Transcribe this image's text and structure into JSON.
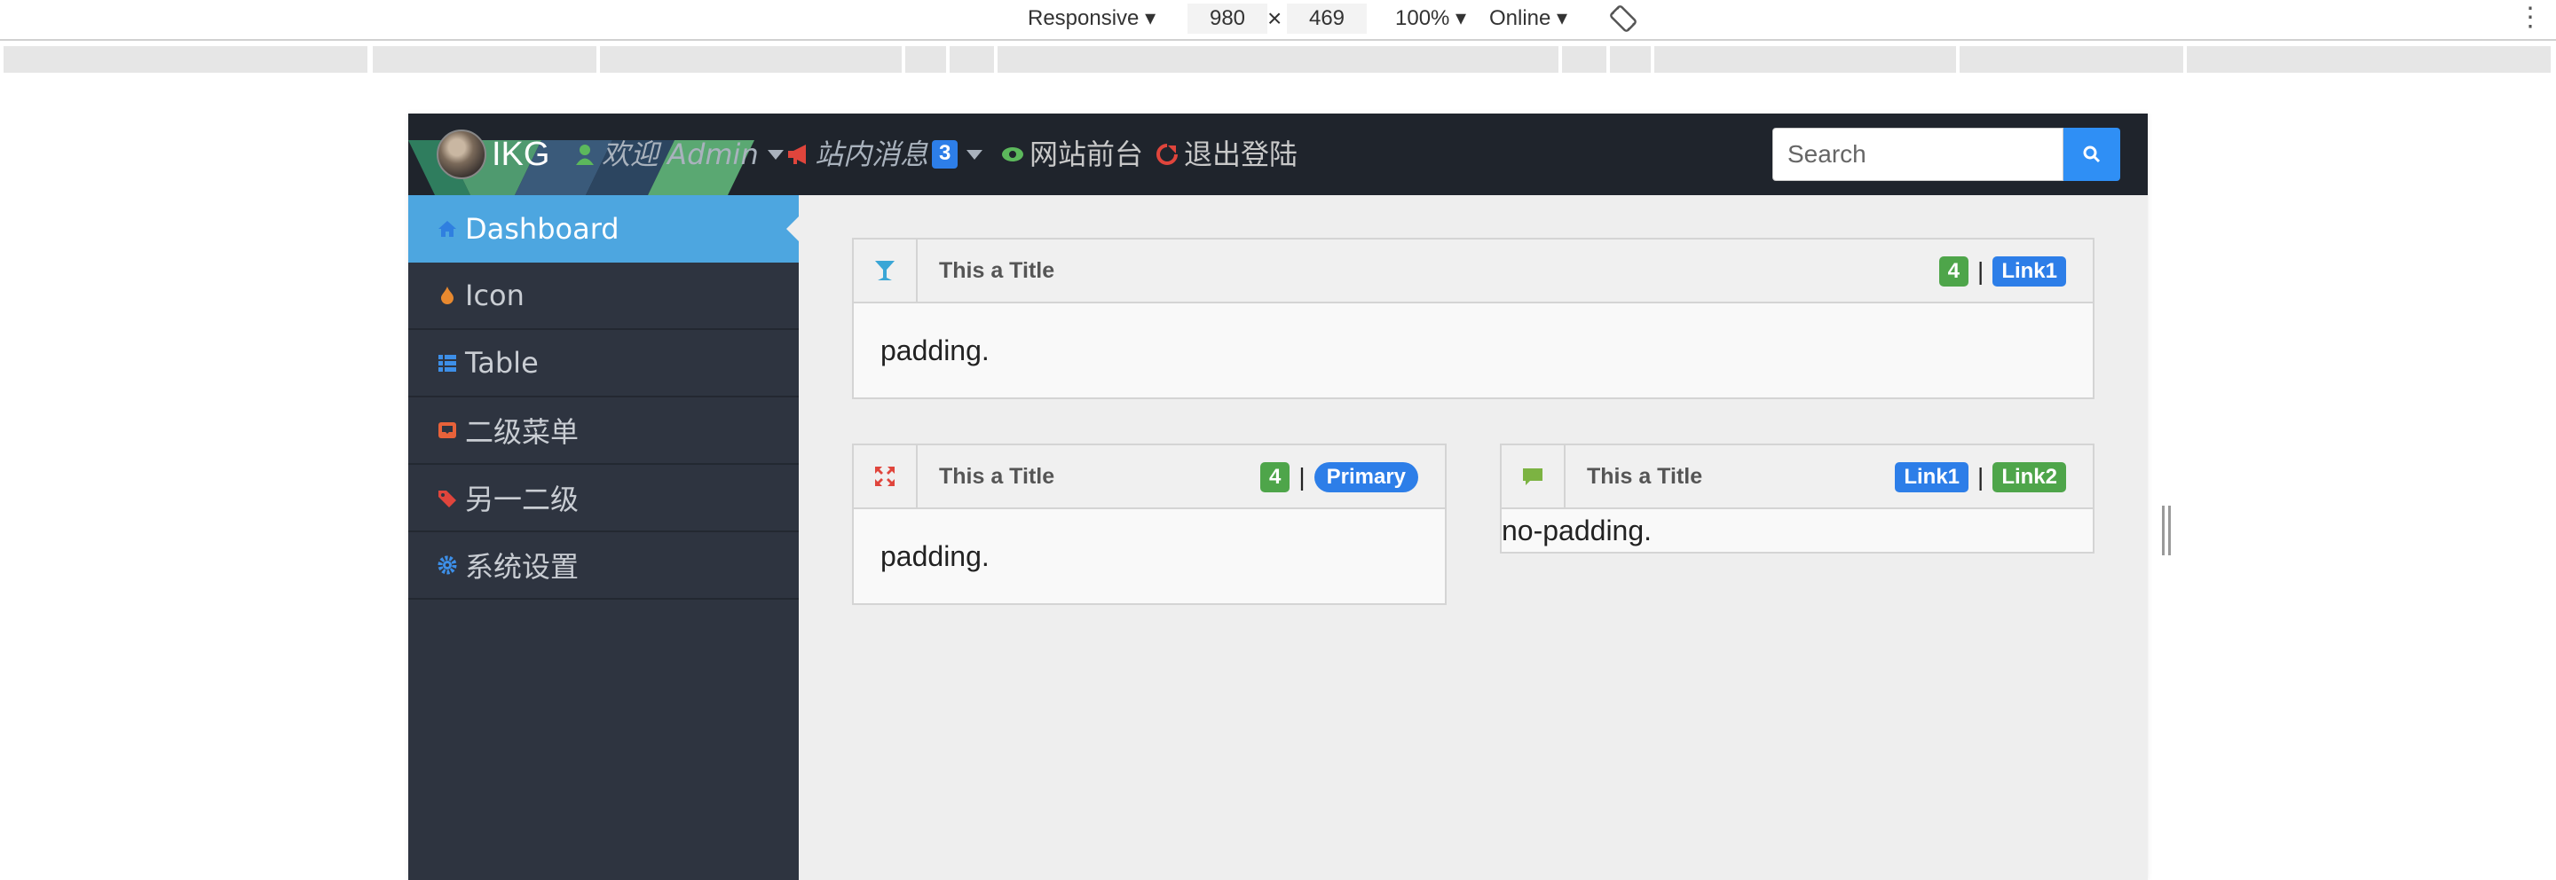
{
  "devtools": {
    "device": "Responsive",
    "width": "980",
    "times": "×",
    "height": "469",
    "zoom": "100%",
    "network": "Online",
    "more": "⋮"
  },
  "topnav": {
    "brand": "IKG",
    "welcome": "欢迎 Admin",
    "messages": "站内消息",
    "messages_count": "3",
    "site_front": "网站前台",
    "logout": "退出登陆",
    "search_placeholder": "Search"
  },
  "sidebar": {
    "items": [
      {
        "label": "Dashboard",
        "icon": "home-icon"
      },
      {
        "label": "Icon",
        "icon": "fire-icon"
      },
      {
        "label": "Table",
        "icon": "list-icon"
      },
      {
        "label": "二级菜单",
        "icon": "inbox-icon"
      },
      {
        "label": "另一二级",
        "icon": "tags-icon"
      },
      {
        "label": "系统设置",
        "icon": "gear-icon"
      }
    ]
  },
  "panels": [
    {
      "icon": "filter-icon",
      "title": "This a Title",
      "badge": "4",
      "link": "Link1",
      "body": "padding."
    },
    {
      "icon": "fullscreen-icon",
      "title": "This a Title",
      "badge": "4",
      "link": "Primary",
      "body": "padding."
    },
    {
      "icon": "comment-icon",
      "title": "This a Title",
      "link1": "Link1",
      "link2": "Link2",
      "body": "no-padding."
    }
  ],
  "colors": {
    "navbar": "#1f242c",
    "sidebar": "#2e3440",
    "active": "#4da6e0",
    "primary": "#2d7ee8",
    "success": "#4ea54a"
  }
}
